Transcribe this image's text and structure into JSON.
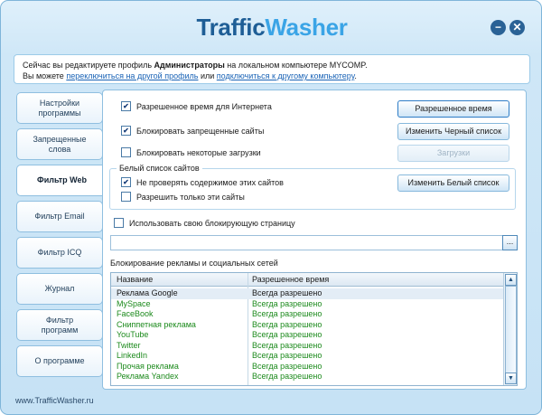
{
  "app": {
    "title_part1": "Traffic",
    "title_part2": "Washer",
    "minimize_glyph": "−",
    "close_glyph": "✕"
  },
  "info": {
    "line1_prefix": "Сейчас вы редактируете профиль ",
    "line1_profile": "Администраторы",
    "line1_suffix": " на локальном компьютере MYCOMP.",
    "line2_prefix": "Вы можете ",
    "link_profile": "переключиться на другой профиль",
    "line2_mid": " или ",
    "link_computer": "подключиться к другому компьютеру",
    "line2_end": "."
  },
  "tabs": [
    {
      "label": "Настройки программы"
    },
    {
      "label": "Запрещенные слова"
    },
    {
      "label": "Фильтр Web"
    },
    {
      "label": "Фильтр Email"
    },
    {
      "label": "Фильтр ICQ"
    },
    {
      "label": "Журнал"
    },
    {
      "label": "Фильтр программ"
    },
    {
      "label": "О программе"
    }
  ],
  "options": {
    "allowed_time": {
      "label": "Разрешенное время для Интернета",
      "checked": true
    },
    "block_sites": {
      "label": "Блокировать запрещенные сайты",
      "checked": true
    },
    "block_downloads": {
      "label": "Блокировать некоторые загрузки",
      "checked": false
    },
    "whitelist_title": "Белый список сайтов",
    "no_check": {
      "label": "Не проверять содержимое этих сайтов",
      "checked": true
    },
    "only_these": {
      "label": "Разрешить только эти сайты",
      "checked": false
    },
    "custom_page": {
      "label": "Использовать свою блокирующую страницу",
      "checked": false
    },
    "path_value": "",
    "browse_label": "..."
  },
  "buttons": {
    "allowed_time": "Разрешенное время",
    "change_black": "Изменить Черный список",
    "downloads": "Загрузки",
    "change_white": "Изменить Белый список"
  },
  "ads": {
    "title": "Блокирование рекламы и социальных сетей",
    "col_name": "Название",
    "col_time": "Разрешенное время",
    "rows": [
      {
        "name": "Реклама Google",
        "time": "Всегда разрешено"
      },
      {
        "name": "MySpace",
        "time": "Всегда разрешено"
      },
      {
        "name": "FaceBook",
        "time": "Всегда разрешено"
      },
      {
        "name": "Сниппетная реклама",
        "time": "Всегда разрешено"
      },
      {
        "name": "YouTube",
        "time": "Всегда разрешено"
      },
      {
        "name": "Twitter",
        "time": "Всегда разрешено"
      },
      {
        "name": "LinkedIn",
        "time": "Всегда разрешено"
      },
      {
        "name": "Прочая реклама",
        "time": "Всегда разрешено"
      },
      {
        "name": "Реклама Yandex",
        "time": "Всегда разрешено"
      }
    ]
  },
  "footer": "www.TrafficWasher.ru",
  "colors": {
    "logo_dark": "#1e5e96",
    "logo_light": "#3aa4e6",
    "row_text_green": "#1c8a1c",
    "link": "#1a63b6"
  }
}
